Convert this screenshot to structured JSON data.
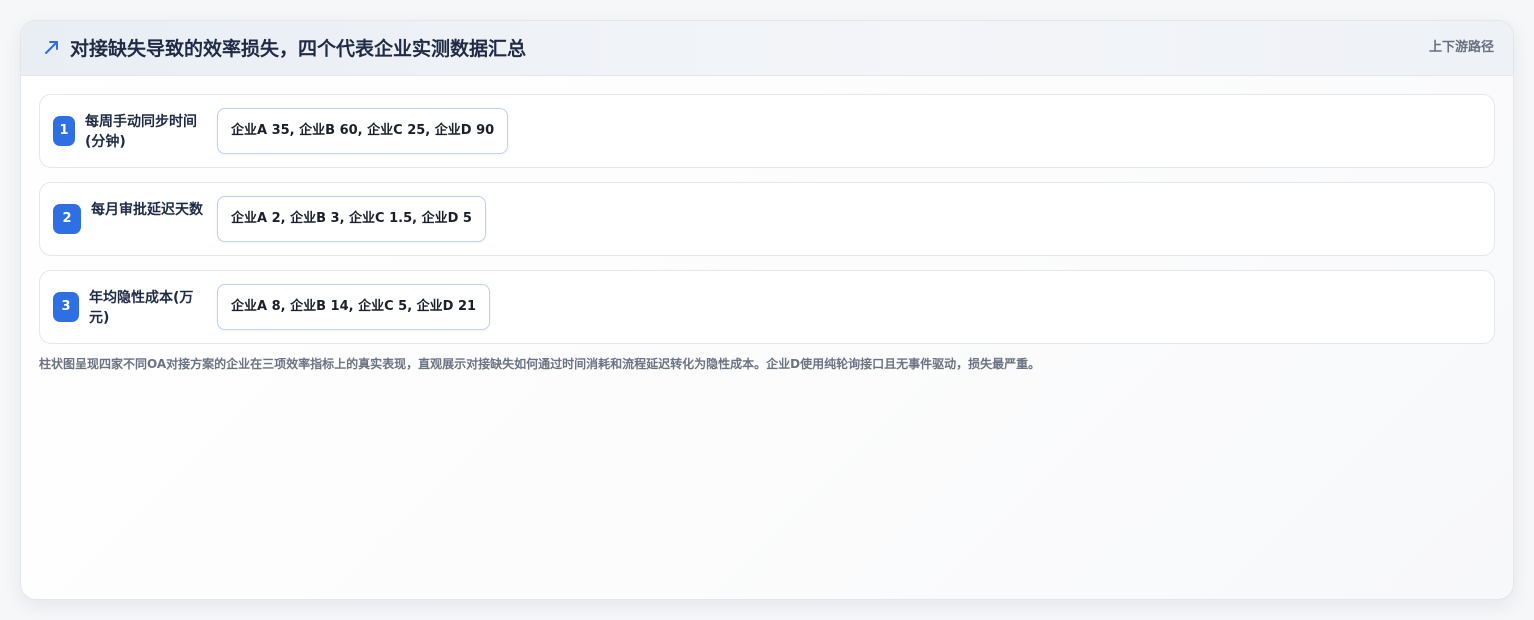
{
  "card": {
    "title": "对接缺失导致的效率损失，四个代表企业实测数据汇总",
    "path_link": "上下游路径",
    "title_icon": "trend-arrow-icon",
    "accent_color": "#2f6fe4"
  },
  "metrics": [
    {
      "index": "1",
      "label": "每周手动同步时间(分钟)",
      "value": "企业A 35, 企业B 60, 企业C 25, 企业D 90"
    },
    {
      "index": "2",
      "label": "每月审批延迟天数",
      "value": "企业A 2, 企业B 3, 企业C 1.5, 企业D 5"
    },
    {
      "index": "3",
      "label": "年均隐性成本(万元)",
      "value": "企业A 8, 企业B 14, 企业C 5, 企业D 21"
    }
  ],
  "caption": "柱状图呈现四家不同OA对接方案的企业在三项效率指标上的真实表现，直观展示对接缺失如何通过时间消耗和流程延迟转化为隐性成本。企业D使用纯轮询接口且无事件驱动，损失最严重。"
}
